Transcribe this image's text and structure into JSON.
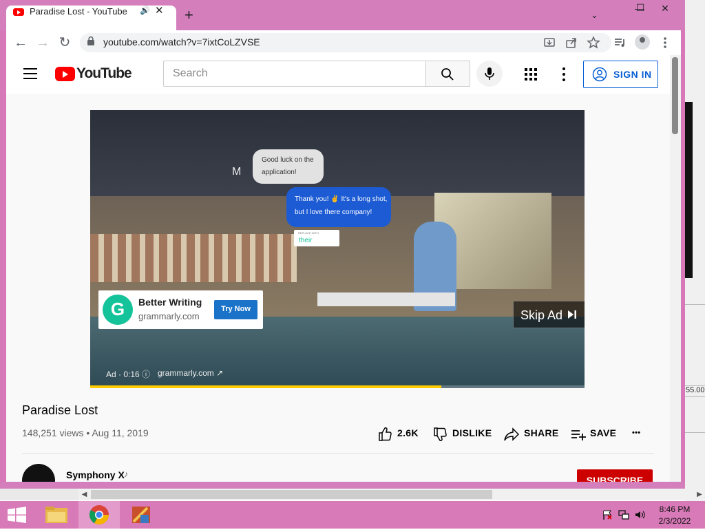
{
  "browser": {
    "tab_title": "Paradise Lost - YouTube",
    "tab_audio": "🔊",
    "tab_close": "✕",
    "new_tab": "+",
    "tab_search": "⌄",
    "window_controls": {
      "minimize": "—",
      "maximize": "☐",
      "close": "✕"
    },
    "url": "youtube.com/watch?v=7ixtCoLZVSE",
    "nav": {
      "back": "←",
      "forward": "→",
      "reload": "↻"
    }
  },
  "youtube": {
    "wordmark": "YouTube",
    "search_placeholder": "Search",
    "signin_label": "SIGN IN"
  },
  "ad": {
    "bubble_sender": "M",
    "bubble_gray_text": "Good luck on the application!",
    "bubble_blue_text": "Thank you! ✌ It's a long shot, but I love there company!",
    "replace_label": "REPLACE WITH",
    "replace_word": "their",
    "headline": "Better Writing",
    "domain": "grammarly.com",
    "cta": "Try Now",
    "skip_label": "Skip Ad",
    "info": "Ad · 0:16 ⓘ",
    "url": "grammarly.com ↗",
    "progress": 0.71
  },
  "video": {
    "title": "Paradise Lost",
    "meta": "148,251 views • Aug 11, 2019",
    "likes": "2.6K",
    "dislike_label": "DISLIKE",
    "share_label": "SHARE",
    "save_label": "SAVE",
    "more": "•••"
  },
  "channel": {
    "name": "Symphony X",
    "note_icon": "♪",
    "subscribe_label": "SUBSCRIBE"
  },
  "background_app": {
    "value": "55.00"
  },
  "taskbar": {
    "time": "8:46 PM",
    "date": "2/3/2022"
  },
  "colors": {
    "window_frame": "#d47fbc",
    "youtube_red": "#ff0000",
    "signin_blue": "#065fd4",
    "ad_progress": "#ffcc00",
    "grammarly_green": "#15c39a",
    "subscribe_red": "#cc0000"
  },
  "icons": {
    "lock": "lock-icon",
    "install": "install-icon",
    "share": "share-icon",
    "bookmark": "star-icon",
    "reading_list": "playlist-icon",
    "profile": "profile-icon",
    "chrome_menu": "kebab-icon",
    "search": "search-icon",
    "mic": "mic-icon",
    "apps": "apps-grid-icon",
    "settings": "kebab-icon",
    "signin_user": "user-circle-icon",
    "like": "thumb-up-icon",
    "dislike": "thumb-down-icon",
    "share_action": "share-arrow-icon",
    "save": "playlist-add-icon",
    "skip": "skip-next-icon"
  }
}
